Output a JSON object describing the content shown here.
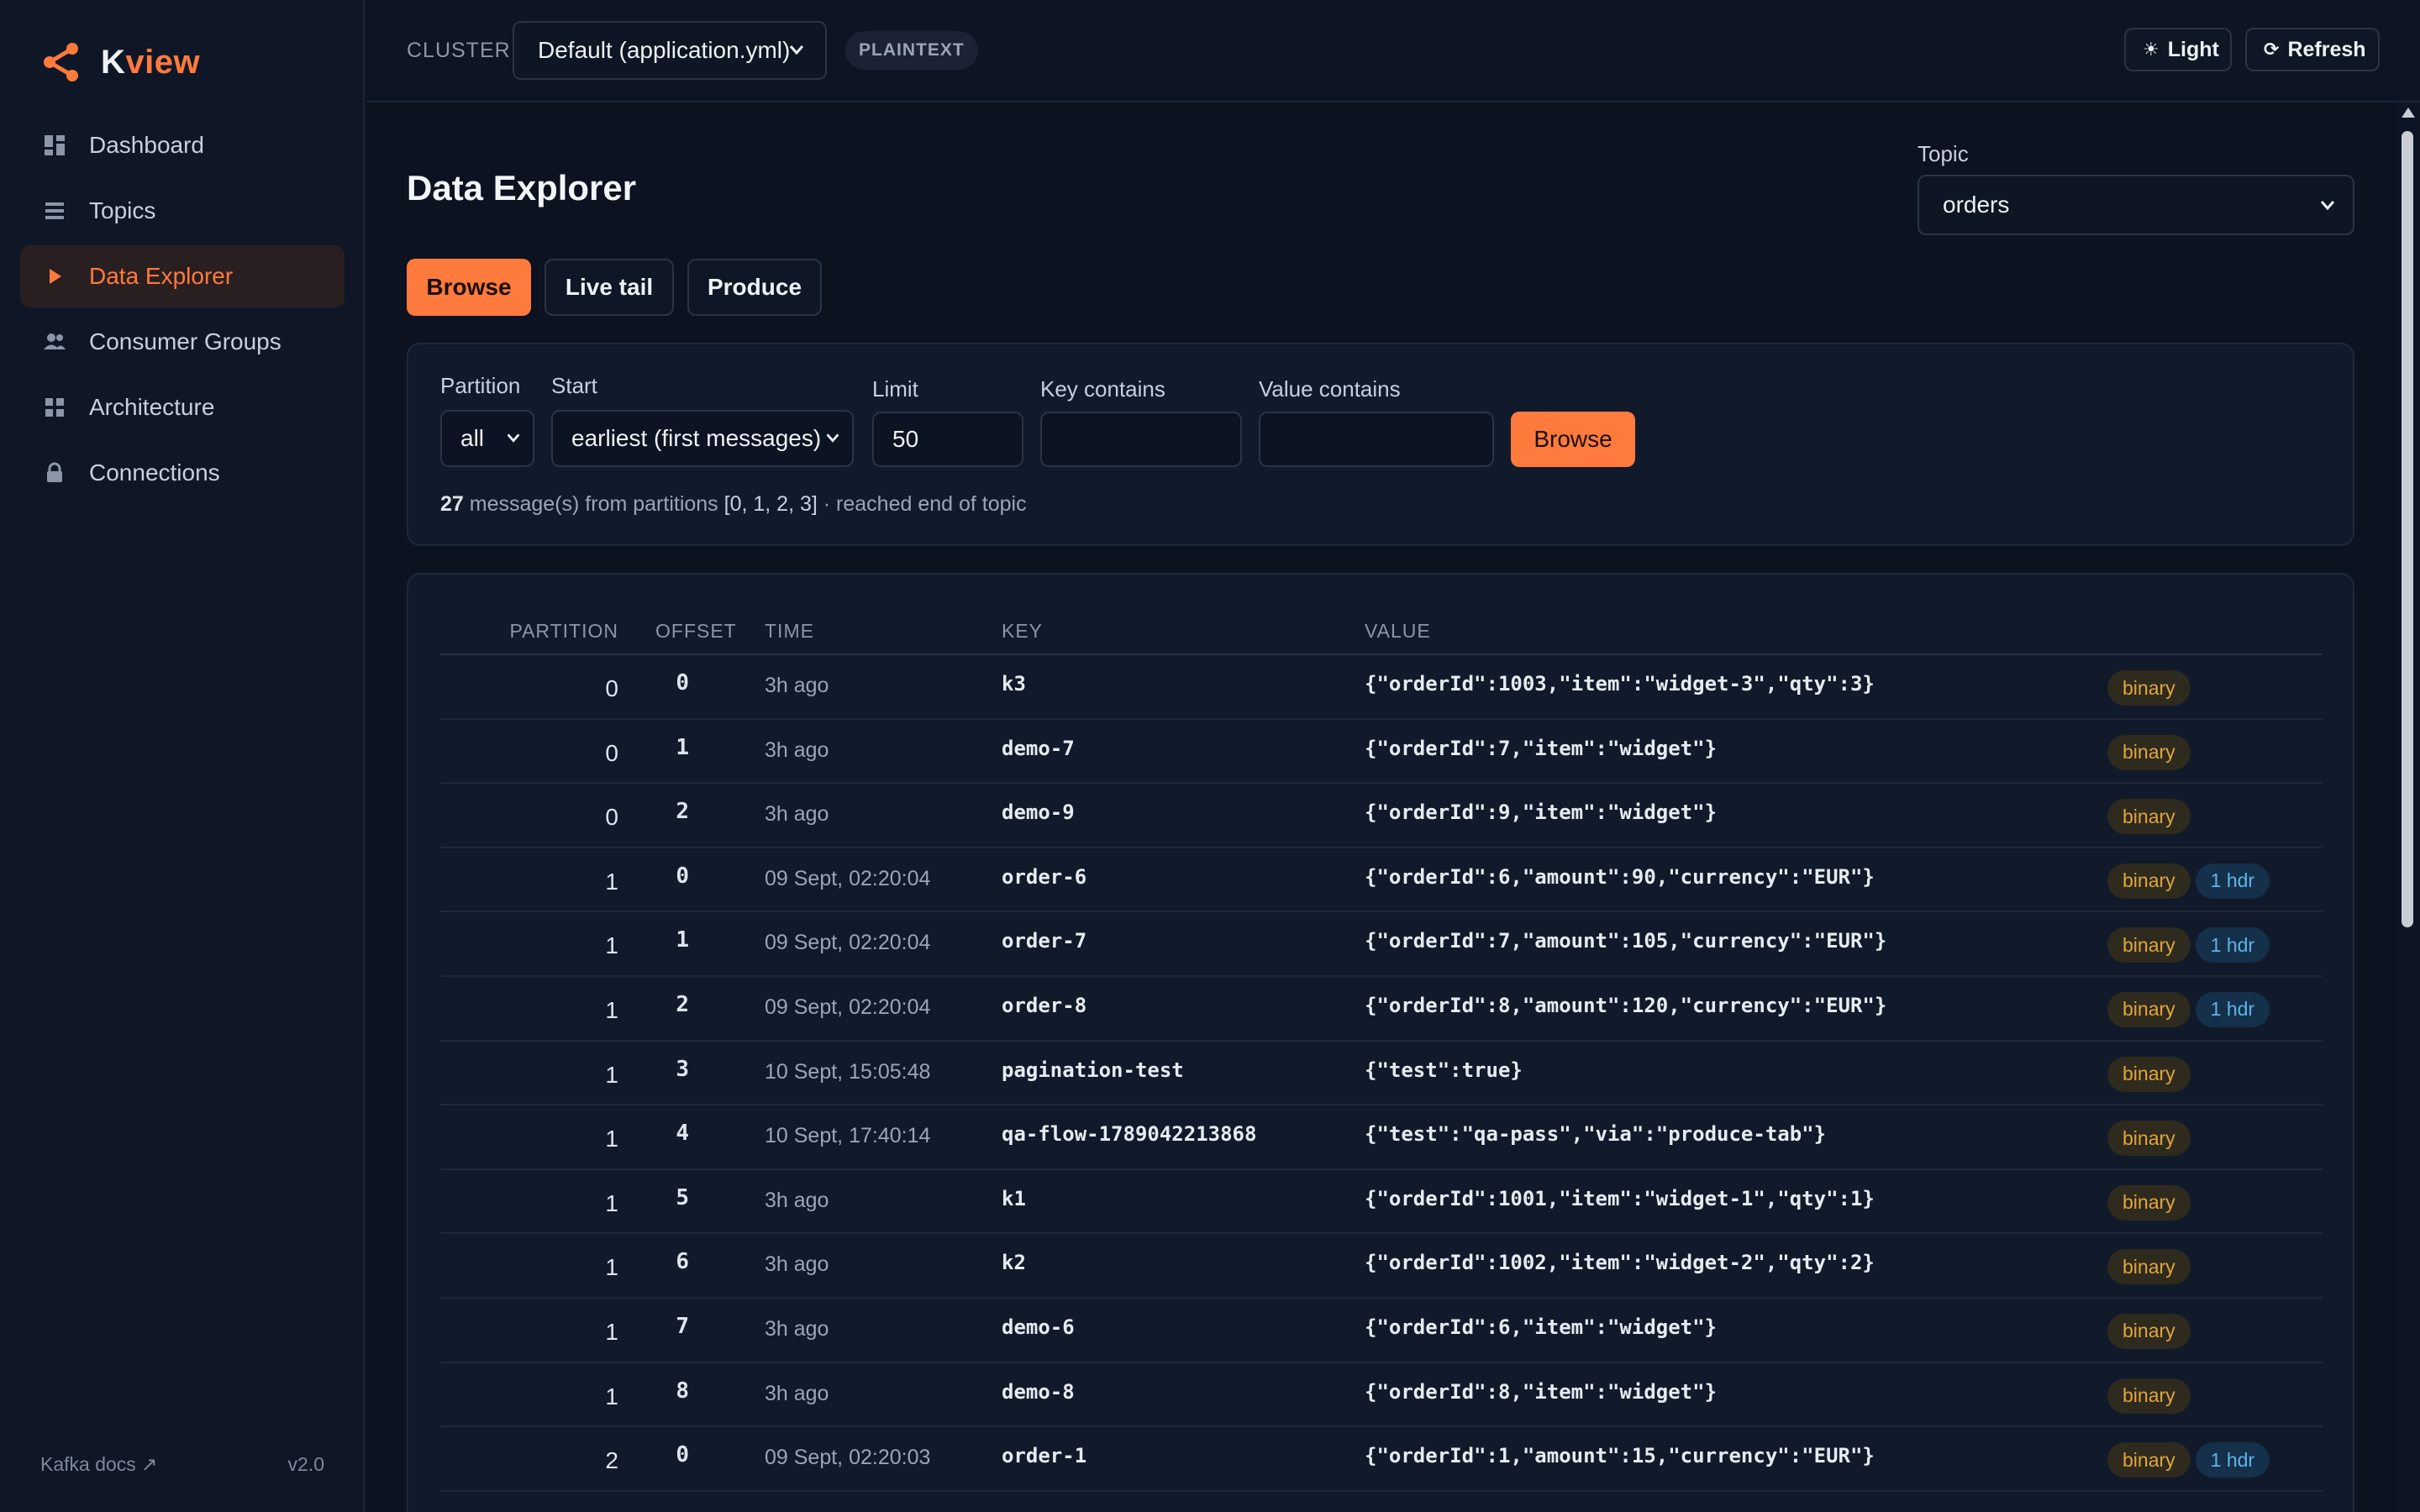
{
  "brand": {
    "prefix": "K",
    "accent": "view"
  },
  "nav": [
    {
      "label": "Dashboard",
      "icon": "dashboard-icon",
      "active": false
    },
    {
      "label": "Topics",
      "icon": "list-icon",
      "active": false
    },
    {
      "label": "Data Explorer",
      "icon": "play-icon",
      "active": true
    },
    {
      "label": "Consumer Groups",
      "icon": "users-icon",
      "active": false
    },
    {
      "label": "Architecture",
      "icon": "grid-icon",
      "active": false
    },
    {
      "label": "Connections",
      "icon": "lock-icon",
      "active": false
    }
  ],
  "footer": {
    "docs": "Kafka docs ↗",
    "version": "v2.0"
  },
  "topbar": {
    "cluster_label": "CLUSTER",
    "cluster_value": "Default (application.yml)",
    "security_badge": "PLAINTEXT",
    "theme_label": "Light",
    "refresh_label": "Refresh"
  },
  "page": {
    "title": "Data Explorer",
    "topic_label": "Topic",
    "topic_value": "orders"
  },
  "tabs": {
    "browse": "Browse",
    "live": "Live tail",
    "produce": "Produce"
  },
  "filters": {
    "partition_label": "Partition",
    "partition_value": "all",
    "start_label": "Start",
    "start_value": "earliest (first messages)",
    "limit_label": "Limit",
    "limit_value": "50",
    "key_label": "Key contains",
    "key_value": "",
    "value_label": "Value contains",
    "value_value": "",
    "browse_label": "Browse",
    "summary_count": "27",
    "summary_mid": " message(s) from partitions ",
    "summary_parts": "[0, 1, 2, 3]",
    "summary_end": " · reached end of topic"
  },
  "table": {
    "headers": {
      "partition": "PARTITION",
      "offset": "OFFSET",
      "time": "TIME",
      "key": "KEY",
      "value": "VALUE"
    },
    "rows": [
      {
        "partition": "0",
        "offset": "0",
        "time": "3h ago",
        "key": "k3",
        "value": "{\"orderId\":1003,\"item\":\"widget-3\",\"qty\":3}",
        "badges": [
          "binary"
        ]
      },
      {
        "partition": "0",
        "offset": "1",
        "time": "3h ago",
        "key": "demo-7",
        "value": "{\"orderId\":7,\"item\":\"widget\"}",
        "badges": [
          "binary"
        ]
      },
      {
        "partition": "0",
        "offset": "2",
        "time": "3h ago",
        "key": "demo-9",
        "value": "{\"orderId\":9,\"item\":\"widget\"}",
        "badges": [
          "binary"
        ]
      },
      {
        "partition": "1",
        "offset": "0",
        "time": "09 Sept, 02:20:04",
        "key": "order-6",
        "value": "{\"orderId\":6,\"amount\":90,\"currency\":\"EUR\"}",
        "badges": [
          "binary",
          "1 hdr"
        ]
      },
      {
        "partition": "1",
        "offset": "1",
        "time": "09 Sept, 02:20:04",
        "key": "order-7",
        "value": "{\"orderId\":7,\"amount\":105,\"currency\":\"EUR\"}",
        "badges": [
          "binary",
          "1 hdr"
        ]
      },
      {
        "partition": "1",
        "offset": "2",
        "time": "09 Sept, 02:20:04",
        "key": "order-8",
        "value": "{\"orderId\":8,\"amount\":120,\"currency\":\"EUR\"}",
        "badges": [
          "binary",
          "1 hdr"
        ]
      },
      {
        "partition": "1",
        "offset": "3",
        "time": "10 Sept, 15:05:48",
        "key": "pagination-test",
        "value": "{\"test\":true}",
        "badges": [
          "binary"
        ]
      },
      {
        "partition": "1",
        "offset": "4",
        "time": "10 Sept, 17:40:14",
        "key": "qa-flow-1789042213868",
        "value": "{\"test\":\"qa-pass\",\"via\":\"produce-tab\"}",
        "badges": [
          "binary"
        ]
      },
      {
        "partition": "1",
        "offset": "5",
        "time": "3h ago",
        "key": "k1",
        "value": "{\"orderId\":1001,\"item\":\"widget-1\",\"qty\":1}",
        "badges": [
          "binary"
        ]
      },
      {
        "partition": "1",
        "offset": "6",
        "time": "3h ago",
        "key": "k2",
        "value": "{\"orderId\":1002,\"item\":\"widget-2\",\"qty\":2}",
        "badges": [
          "binary"
        ]
      },
      {
        "partition": "1",
        "offset": "7",
        "time": "3h ago",
        "key": "demo-6",
        "value": "{\"orderId\":6,\"item\":\"widget\"}",
        "badges": [
          "binary"
        ]
      },
      {
        "partition": "1",
        "offset": "8",
        "time": "3h ago",
        "key": "demo-8",
        "value": "{\"orderId\":8,\"item\":\"widget\"}",
        "badges": [
          "binary"
        ]
      },
      {
        "partition": "2",
        "offset": "0",
        "time": "09 Sept, 02:20:03",
        "key": "order-1",
        "value": "{\"orderId\":1,\"amount\":15,\"currency\":\"EUR\"}",
        "badges": [
          "binary",
          "1 hdr"
        ]
      }
    ]
  },
  "colors": {
    "accent": "#ff7a3d",
    "background": "#0c1220",
    "sidebar": "#0f1726",
    "binary_badge": "#e0a63a",
    "header_badge": "#5fb4e6"
  }
}
